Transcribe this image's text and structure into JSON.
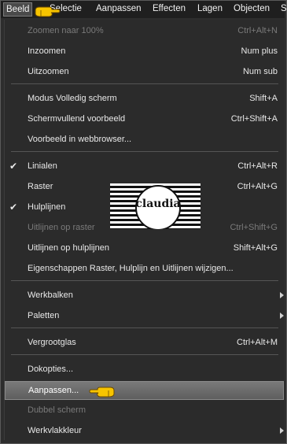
{
  "menubar": {
    "items": [
      {
        "label": "Beeld"
      },
      {
        "label": "Selectie"
      },
      {
        "label": "Aanpassen"
      },
      {
        "label": "Effecten"
      },
      {
        "label": "Lagen"
      },
      {
        "label": "Objecten"
      },
      {
        "label": "S"
      }
    ]
  },
  "menu": {
    "items": [
      {
        "label": "Zoomen naar 100%",
        "shortcut": "Ctrl+Alt+N",
        "disabled": true
      },
      {
        "label": "Inzoomen",
        "shortcut": "Num plus"
      },
      {
        "label": "Uitzoomen",
        "shortcut": "Num sub"
      },
      {
        "label": "Modus Volledig scherm",
        "shortcut": "Shift+A"
      },
      {
        "label": "Schermvullend voorbeeld",
        "shortcut": "Ctrl+Shift+A"
      },
      {
        "label": "Voorbeeld in webbrowser...",
        "shortcut": ""
      },
      {
        "label": "Linialen",
        "shortcut": "Ctrl+Alt+R",
        "checked": true
      },
      {
        "label": "Raster",
        "shortcut": "Ctrl+Alt+G"
      },
      {
        "label": "Hulplijnen",
        "shortcut": "",
        "checked": true
      },
      {
        "label": "Uitlijnen op raster",
        "shortcut": "Ctrl+Shift+G",
        "disabled": true
      },
      {
        "label": "Uitlijnen op hulplijnen",
        "shortcut": "Shift+Alt+G"
      },
      {
        "label": "Eigenschappen Raster, Hulplijn en Uitlijnen wijzigen...",
        "shortcut": ""
      },
      {
        "label": "Werkbalken",
        "shortcut": "",
        "submenu": true
      },
      {
        "label": "Paletten",
        "shortcut": "",
        "submenu": true
      },
      {
        "label": "Vergrootglas",
        "shortcut": "Ctrl+Alt+M"
      },
      {
        "label": "Dokopties...",
        "shortcut": ""
      },
      {
        "label": "Aanpassen...",
        "shortcut": "",
        "highlighted": true
      },
      {
        "label": "Dubbel scherm",
        "shortcut": "",
        "disabled": true
      },
      {
        "label": "Werkvlakkleur",
        "shortcut": "",
        "submenu": true
      }
    ]
  },
  "watermark": {
    "text": "claudia"
  },
  "icons": {
    "check": "checkmark-icon",
    "submenu": "chevron-right-icon",
    "pointer": "pointing-hand-icon"
  }
}
